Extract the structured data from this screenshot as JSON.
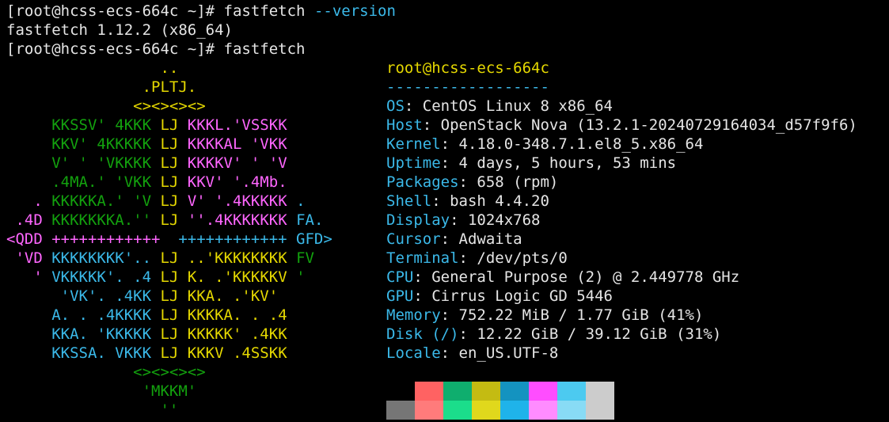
{
  "terminal": {
    "lines": [
      {
        "prompt": "[root@hcss-ecs-664c ~]# ",
        "cmd": "fastfetch",
        "arg": " --version"
      },
      {
        "output": "fastfetch 1.12.2 (x86_64)"
      },
      {
        "prompt": "[root@hcss-ecs-664c ~]# ",
        "cmd": "fastfetch",
        "arg": ""
      }
    ]
  },
  "logo": [
    [
      {
        "t": "                 ..",
        "c": "y"
      }
    ],
    [
      {
        "t": "               .PLTJ.",
        "c": "y"
      }
    ],
    [
      {
        "t": "              <><><><>",
        "c": "y"
      }
    ],
    [
      {
        "t": "     KKSSV' 4KKK ",
        "c": "g"
      },
      {
        "t": "LJ",
        "c": "y"
      },
      {
        "t": " KKKL.'VSSKK",
        "c": "m"
      }
    ],
    [
      {
        "t": "     KKV' 4KKKKK ",
        "c": "g"
      },
      {
        "t": "LJ",
        "c": "y"
      },
      {
        "t": " KKKKAL 'VKK",
        "c": "m"
      }
    ],
    [
      {
        "t": "     V' ' 'VKKKK ",
        "c": "g"
      },
      {
        "t": "LJ",
        "c": "y"
      },
      {
        "t": " KKKKV' ' 'V",
        "c": "m"
      }
    ],
    [
      {
        "t": "     .4MA.' 'VKK ",
        "c": "g"
      },
      {
        "t": "LJ",
        "c": "y"
      },
      {
        "t": " KKV' '.4Mb.",
        "c": "m"
      }
    ],
    [
      {
        "t": "   . ",
        "c": "m"
      },
      {
        "t": "KKKKKA.' 'V ",
        "c": "g"
      },
      {
        "t": "LJ",
        "c": "y"
      },
      {
        "t": " V' '.4KKKKK ",
        "c": "m"
      },
      {
        "t": ".",
        "c": "c"
      }
    ],
    [
      {
        "t": " .4D ",
        "c": "m"
      },
      {
        "t": "KKKKKKKA.'' ",
        "c": "g"
      },
      {
        "t": "LJ",
        "c": "y"
      },
      {
        "t": " ''.4KKKKKKK ",
        "c": "m"
      },
      {
        "t": "FA.",
        "c": "c"
      }
    ],
    [
      {
        "t": "<QDD ++++++++++++  ",
        "c": "m"
      },
      {
        "t": "++++++++++++ GFD>",
        "c": "c"
      }
    ],
    [
      {
        "t": " 'VD ",
        "c": "m"
      },
      {
        "t": "KKKKKKKK'.. ",
        "c": "c"
      },
      {
        "t": "LJ",
        "c": "y"
      },
      {
        "t": " ..'KKKKKKKK ",
        "c": "y"
      },
      {
        "t": "FV",
        "c": "g"
      }
    ],
    [
      {
        "t": "   ' ",
        "c": "m"
      },
      {
        "t": "VKKKKK'. .4 ",
        "c": "c"
      },
      {
        "t": "LJ",
        "c": "y"
      },
      {
        "t": " K. .'KKKKKV ",
        "c": "y"
      },
      {
        "t": "'",
        "c": "g"
      }
    ],
    [
      {
        "t": "      'VK'. .4KK ",
        "c": "c"
      },
      {
        "t": "LJ",
        "c": "y"
      },
      {
        "t": " KKA. .'KV'",
        "c": "y"
      }
    ],
    [
      {
        "t": "     A. . .4KKKK ",
        "c": "c"
      },
      {
        "t": "LJ",
        "c": "y"
      },
      {
        "t": " KKKKA. . .4",
        "c": "y"
      }
    ],
    [
      {
        "t": "     KKA. 'KKKKK ",
        "c": "c"
      },
      {
        "t": "LJ",
        "c": "y"
      },
      {
        "t": " KKKKK' .4KK",
        "c": "y"
      }
    ],
    [
      {
        "t": "     KKSSA. VKKK ",
        "c": "c"
      },
      {
        "t": "LJ",
        "c": "y"
      },
      {
        "t": " KKKV .4SSKK",
        "c": "y"
      }
    ],
    [
      {
        "t": "              <><><><>",
        "c": "g"
      }
    ],
    [
      {
        "t": "               'MKKM'",
        "c": "g"
      }
    ],
    [
      {
        "t": "                 ''",
        "c": "g"
      }
    ]
  ],
  "info": {
    "user": "root@hcss-ecs-664c",
    "separator": "------------------",
    "rows": [
      {
        "key": "OS",
        "value": "CentOS Linux 8 x86_64"
      },
      {
        "key": "Host",
        "value": "OpenStack Nova (13.2.1-20240729164034_d57f9f6)"
      },
      {
        "key": "Kernel",
        "value": "4.18.0-348.7.1.el8_5.x86_64"
      },
      {
        "key": "Uptime",
        "value": "4 days, 5 hours, 53 mins"
      },
      {
        "key": "Packages",
        "value": "658 (rpm)"
      },
      {
        "key": "Shell",
        "value": "bash 4.4.20"
      },
      {
        "key": "Display",
        "value": "1024x768"
      },
      {
        "key": "Cursor",
        "value": "Adwaita"
      },
      {
        "key": "Terminal",
        "value": "/dev/pts/0"
      },
      {
        "key": "CPU",
        "value": "General Purpose (2) @ 2.449778 GHz"
      },
      {
        "key": "GPU",
        "value": "Cirrus Logic GD 5446"
      },
      {
        "key": "Memory",
        "value": "752.22 MiB / 1.77 GiB (41%)"
      },
      {
        "key": "Disk (/)",
        "value": "12.22 GiB / 39.12 GiB (31%)"
      },
      {
        "key": "Locale",
        "value": "en_US.UTF-8"
      }
    ]
  },
  "palette": {
    "row1": [
      "#000000",
      "#ff6262",
      "#0fae6e",
      "#c4bb12",
      "#1493c0",
      "#ff4dff",
      "#4ccaf0",
      "#cccccc"
    ],
    "row2": [
      "#767676",
      "#ff7b7b",
      "#1bdd8b",
      "#e0d81c",
      "#1fb3ea",
      "#ff8cff",
      "#88dbf5",
      "#cccccc"
    ]
  },
  "colors": {
    "background": "#000000",
    "text": "#e5e5e5",
    "key": "#3bb9e9",
    "user": "#e5d800"
  }
}
